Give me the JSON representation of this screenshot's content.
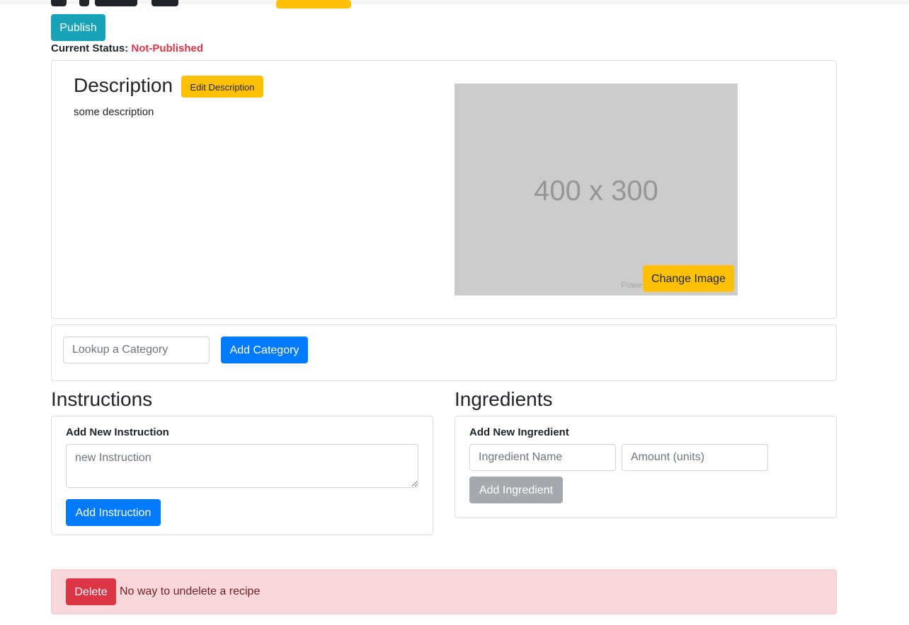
{
  "header": {
    "publish_label": "Publish",
    "status_label": "Current Status:",
    "status_value": "Not-Published"
  },
  "description": {
    "heading": "Description",
    "edit_label": "Edit Description",
    "text": "some description",
    "image_placeholder": "400 x 300",
    "image_caption": "Powe",
    "change_image_label": "Change Image"
  },
  "category": {
    "input_placeholder": "Lookup a Category",
    "add_label": "Add Category"
  },
  "instructions": {
    "heading": "Instructions",
    "sub_label": "Add New Instruction",
    "input_placeholder": "new Instruction",
    "add_label": "Add Instruction"
  },
  "ingredients": {
    "heading": "Ingredients",
    "sub_label": "Add New Ingredient",
    "name_placeholder": "Ingredient Name",
    "amount_placeholder": "Amount (units)",
    "add_label": "Add Ingredient"
  },
  "danger": {
    "delete_label": "Delete",
    "warning_text": "No way to undelete a recipe"
  },
  "colors": {
    "info": "#17a2b8",
    "warning": "#ffc107",
    "primary": "#007bff",
    "secondary": "#a5a9ad",
    "danger": "#dc3545",
    "danger_bg": "#f8d7da"
  }
}
